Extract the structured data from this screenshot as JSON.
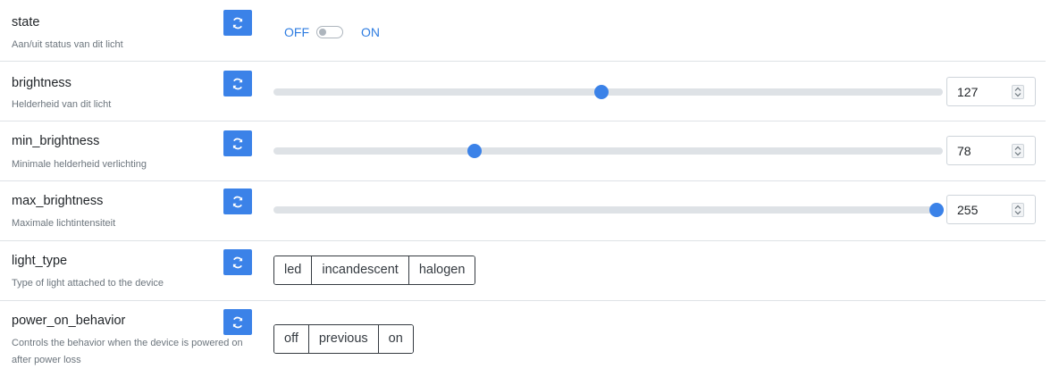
{
  "rows": [
    {
      "name": "state",
      "description": "Aan/uit status van dit licht",
      "toggle": {
        "off_label": "OFF",
        "on_label": "ON",
        "value": "OFF"
      }
    },
    {
      "name": "brightness",
      "description": "Helderheid van dit licht",
      "value": "127",
      "slider_fraction": 0.49
    },
    {
      "name": "min_brightness",
      "description": "Minimale helderheid verlichting",
      "value": "78",
      "slider_fraction": 0.3
    },
    {
      "name": "max_brightness",
      "description": "Maximale lichtintensiteit",
      "value": "255",
      "slider_fraction": 0.99
    },
    {
      "name": "light_type",
      "description": "Type of light attached to the device",
      "options": [
        "led",
        "incandescent",
        "halogen"
      ]
    },
    {
      "name": "power_on_behavior",
      "description": "Controls the behavior when the device is powered on after power loss",
      "options": [
        "off",
        "previous",
        "on"
      ]
    }
  ],
  "colors": {
    "accent": "#3b82e8",
    "toggle_text": "#2f7de1",
    "track": "#dee2e6"
  },
  "icons": {
    "refresh": "refresh-icon"
  }
}
